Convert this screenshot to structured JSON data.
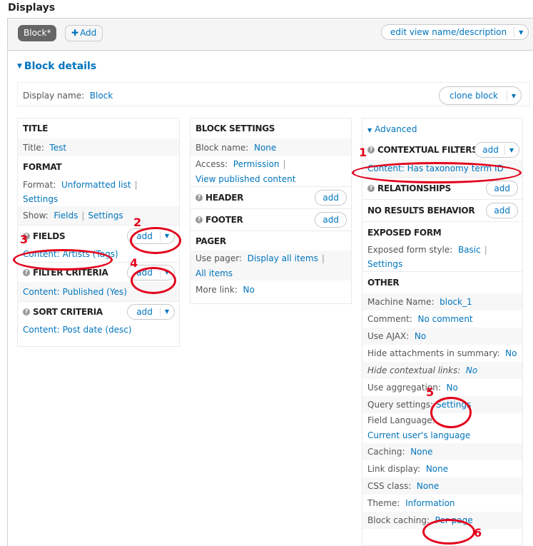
{
  "page": {
    "title": "Displays"
  },
  "display_bar": {
    "tabs": [
      {
        "label": "Block*",
        "active": true
      }
    ],
    "add_label": "Add",
    "edit_view_label": "edit view name/description"
  },
  "details": {
    "toggle_label": "Block details",
    "display_name_label": "Display name:",
    "display_name_value": "Block",
    "clone_label": "clone block"
  },
  "col1": {
    "title_heading": "TITLE",
    "title_label": "Title:",
    "title_value": "Test",
    "format_heading": "FORMAT",
    "format_label": "Format:",
    "format_value": "Unformatted list",
    "format_settings": "Settings",
    "show_label": "Show:",
    "show_value": "Fields",
    "show_settings": "Settings",
    "fields_heading": "FIELDS",
    "fields_add": "add",
    "fields_item": "Content: Artists (Tags)",
    "filter_heading": "FILTER CRITERIA",
    "filter_add": "add",
    "filter_item": "Content: Published (Yes)",
    "sort_heading": "SORT CRITERIA",
    "sort_add": "add",
    "sort_item": "Content: Post date (desc)"
  },
  "col2": {
    "block_settings_heading": "BLOCK SETTINGS",
    "block_name_label": "Block name:",
    "block_name_value": "None",
    "access_label": "Access:",
    "access_value": "Permission",
    "access_detail": "View published content",
    "header_heading": "HEADER",
    "header_add": "add",
    "footer_heading": "FOOTER",
    "footer_add": "add",
    "pager_heading": "PAGER",
    "use_pager_label": "Use pager:",
    "use_pager_value": "Display all items",
    "use_pager_detail": "All items",
    "more_link_label": "More link:",
    "more_link_value": "No"
  },
  "col3": {
    "advanced_label": "Advanced",
    "contextual_heading": "CONTEXTUAL FILTERS",
    "contextual_add": "add",
    "contextual_item": "Content: Has taxonomy term ID",
    "relationships_heading": "RELATIONSHIPS",
    "relationships_add": "add",
    "no_results_heading": "NO RESULTS BEHAVIOR",
    "no_results_add": "add",
    "exposed_heading": "EXPOSED FORM",
    "exposed_style_label": "Exposed form style:",
    "exposed_style_value": "Basic",
    "exposed_settings": "Settings",
    "other_heading": "OTHER",
    "machine_name_label": "Machine Name:",
    "machine_name_value": "block_1",
    "comment_label": "Comment:",
    "comment_value": "No comment",
    "ajax_label": "Use AJAX:",
    "ajax_value": "No",
    "hide_attach_label": "Hide attachments in summary:",
    "hide_attach_value": "No",
    "hide_ctx_label": "Hide contextual links:",
    "hide_ctx_value": "No",
    "aggregation_label": "Use aggregation:",
    "aggregation_value": "No",
    "query_label": "Query settings:",
    "query_value": "Settings",
    "field_lang_label": "Field Language:",
    "field_lang_value": "Current user's language",
    "caching_label": "Caching:",
    "caching_value": "None",
    "link_display_label": "Link display:",
    "link_display_value": "None",
    "css_class_label": "CSS class:",
    "css_class_value": "None",
    "theme_label": "Theme:",
    "theme_value": "Information",
    "block_caching_label": "Block caching:",
    "block_caching_value": "Per page"
  },
  "annotations": {
    "color": "#e3001b",
    "labels": [
      "1",
      "2",
      "3",
      "4",
      "5",
      "6"
    ]
  },
  "colors": {
    "link": "#0074bd",
    "tab_active_bg": "#666666",
    "bar_bg": "#f5f5f5"
  }
}
